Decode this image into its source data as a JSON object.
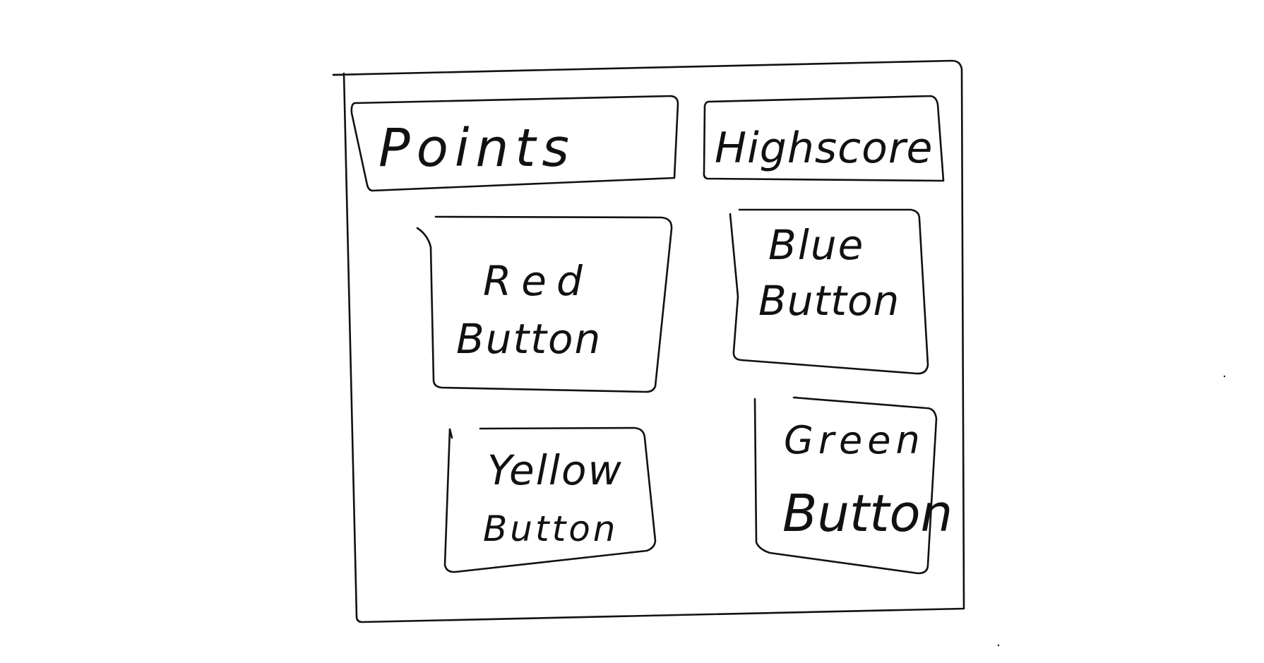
{
  "points_label": "Points",
  "highscore_label": "Highscore",
  "buttons": {
    "red": {
      "line1": "Red",
      "line2": "Button"
    },
    "blue": {
      "line1": "Blue",
      "line2": "Button"
    },
    "yellow": {
      "line1": "Yellow",
      "line2": "Button"
    },
    "green": {
      "line1": "Green",
      "line2": "Button"
    }
  },
  "colors": {
    "ink": "#111111",
    "background": "#ffffff"
  }
}
